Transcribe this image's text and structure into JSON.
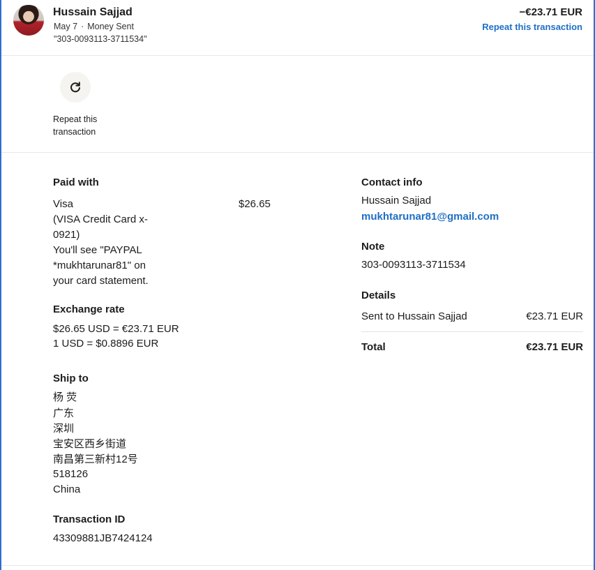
{
  "header": {
    "name": "Hussain Sajjad",
    "date": "May 7",
    "type": "Money Sent",
    "memo": "\"303-0093113-3711534\"",
    "amount": "−€23.71 EUR",
    "repeat_link": "Repeat this transaction"
  },
  "actions": {
    "repeat_label": "Repeat this transaction"
  },
  "paid_with": {
    "title": "Paid with",
    "method_lines": [
      "Visa",
      "(VISA Credit Card x-",
      "0921)",
      "You'll see \"PAYPAL",
      "*mukhtarunar81\" on",
      "your card statement."
    ],
    "amount": "$26.65"
  },
  "exchange_rate": {
    "title": "Exchange rate",
    "line1": "$26.65 USD = €23.71 EUR",
    "line2": "1 USD = $0.8896 EUR"
  },
  "ship_to": {
    "title": "Ship to",
    "lines": [
      "杨 荧",
      "广东",
      "深圳",
      "宝安区西乡街道",
      "南昌第三新村12号",
      "518126",
      "China"
    ]
  },
  "transaction_id": {
    "title": "Transaction ID",
    "value": "43309881JB7424124"
  },
  "contact": {
    "title": "Contact info",
    "name": "Hussain Sajjad",
    "email": "mukhtarunar81@gmail.com"
  },
  "note": {
    "title": "Note",
    "value": "303-0093113-3711534"
  },
  "details": {
    "title": "Details",
    "sent_label": "Sent to Hussain Sajjad",
    "sent_amount": "€23.71 EUR",
    "total_label": "Total",
    "total_amount": "€23.71 EUR"
  },
  "colors": {
    "accent": "#1f6fc5",
    "frame": "#2f6ecf"
  }
}
